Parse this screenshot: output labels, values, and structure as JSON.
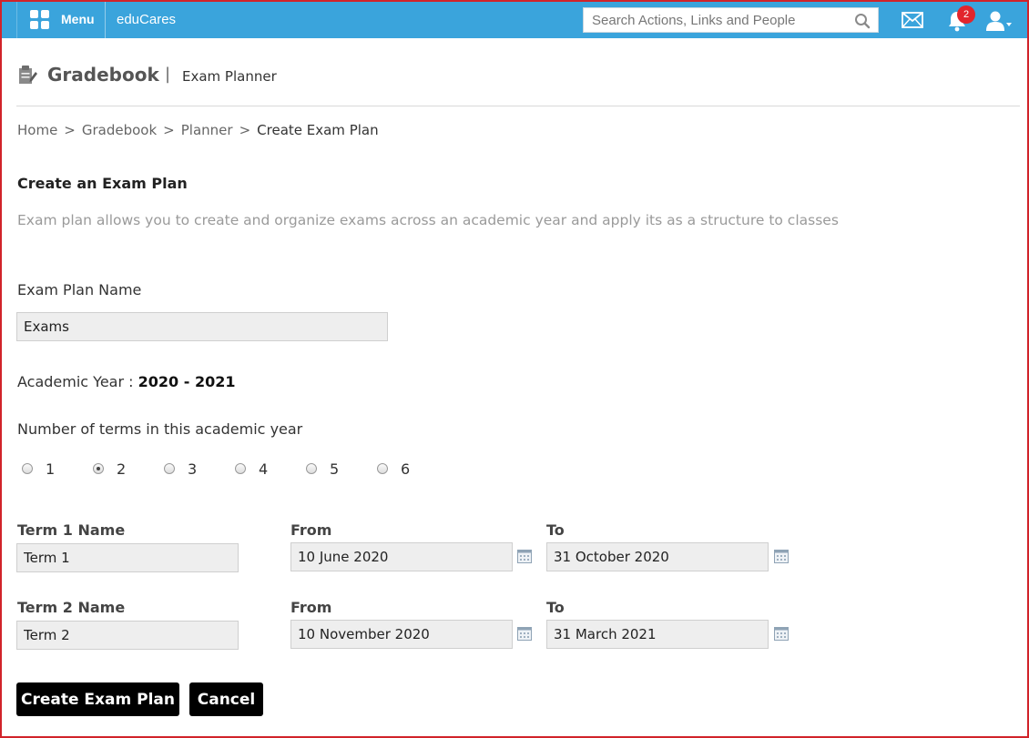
{
  "topbar": {
    "menu_label": "Menu",
    "app_name": "eduCares",
    "search_placeholder": "Search Actions, Links and People",
    "notification_count": "2",
    "accent_color": "#3aa4dc"
  },
  "header": {
    "title": "Gradebook",
    "separator": "|",
    "subtitle": "Exam Planner"
  },
  "breadcrumb": {
    "items": [
      "Home",
      "Gradebook",
      "Planner",
      "Create Exam Plan"
    ],
    "separator": ">"
  },
  "form": {
    "section_title": "Create an Exam Plan",
    "description": "Exam plan allows you to create and organize exams across an academic year and apply its as a structure to classes",
    "plan_name_label": "Exam Plan Name",
    "plan_name_value": "Exams",
    "academic_year_label": "Academic Year :",
    "academic_year_value": "2020 - 2021",
    "terms_count_label": "Number of terms in this academic year",
    "term_options": [
      "1",
      "2",
      "3",
      "4",
      "5",
      "6"
    ],
    "selected_terms": "2",
    "terms": [
      {
        "name_label": "Term 1 Name",
        "name_value": "Term 1",
        "from_label": "From",
        "from_value": "10 June 2020",
        "to_label": "To",
        "to_value": "31 October 2020"
      },
      {
        "name_label": "Term 2 Name",
        "name_value": "Term 2",
        "from_label": "From",
        "from_value": "10 November 2020",
        "to_label": "To",
        "to_value": "31 March 2021"
      }
    ],
    "create_button": "Create Exam Plan",
    "cancel_button": "Cancel"
  }
}
